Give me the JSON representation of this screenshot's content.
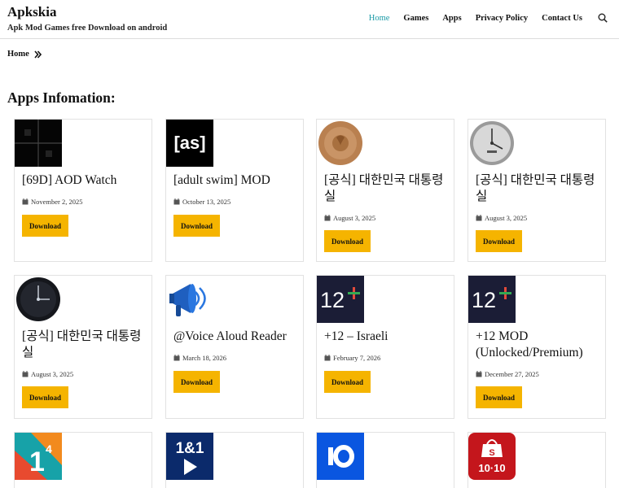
{
  "site": {
    "title": "Apkskia",
    "tagline": "Apk Mod Games free Download on android"
  },
  "nav": {
    "items": [
      {
        "label": "Home",
        "active": true
      },
      {
        "label": "Games",
        "active": false
      },
      {
        "label": "Apps",
        "active": false
      },
      {
        "label": "Privacy Policy",
        "active": false
      },
      {
        "label": "Contact Us",
        "active": false
      }
    ],
    "search_icon": "search-icon"
  },
  "breadcrumb": {
    "home": "Home"
  },
  "section": {
    "title": "Apps Infomation:"
  },
  "download_label": "Download",
  "colors": {
    "accent": "#1a9aa6",
    "button": "#f5b400",
    "border": "#e2e2e2"
  },
  "cards": [
    {
      "title": "[69D] AOD Watch",
      "date": "November 2, 2025",
      "icon": "aod-watch-icon"
    },
    {
      "title": "[adult swim] MOD",
      "date": "October 13, 2025",
      "icon": "adult-swim-icon"
    },
    {
      "title": "[공식] 대한민국 대통령실",
      "date": "August 3, 2025",
      "icon": "watch-face-bronze-icon"
    },
    {
      "title": "[공식] 대한민국 대통령실",
      "date": "August 3, 2025",
      "icon": "watch-face-silver-icon"
    },
    {
      "title": "[공식] 대한민국 대통령실",
      "date": "August 3, 2025",
      "icon": "watch-face-dark-icon"
    },
    {
      "title": "@Voice Aloud Reader",
      "date": "March 18, 2026",
      "icon": "megaphone-icon"
    },
    {
      "title": "+12 – Israeli",
      "date": "February 7, 2026",
      "icon": "channel-12-icon"
    },
    {
      "title": "+12 MOD (Unlocked/Premium)",
      "date": "December 27, 2025",
      "icon": "channel-12-icon"
    },
    {
      "title": "",
      "date": "",
      "icon": "one-four-icon"
    },
    {
      "title": "",
      "date": "",
      "icon": "one-and-one-icon"
    },
    {
      "title": "",
      "date": "",
      "icon": "ten-icon"
    },
    {
      "title": "",
      "date": "",
      "icon": "shopee-icon"
    }
  ]
}
